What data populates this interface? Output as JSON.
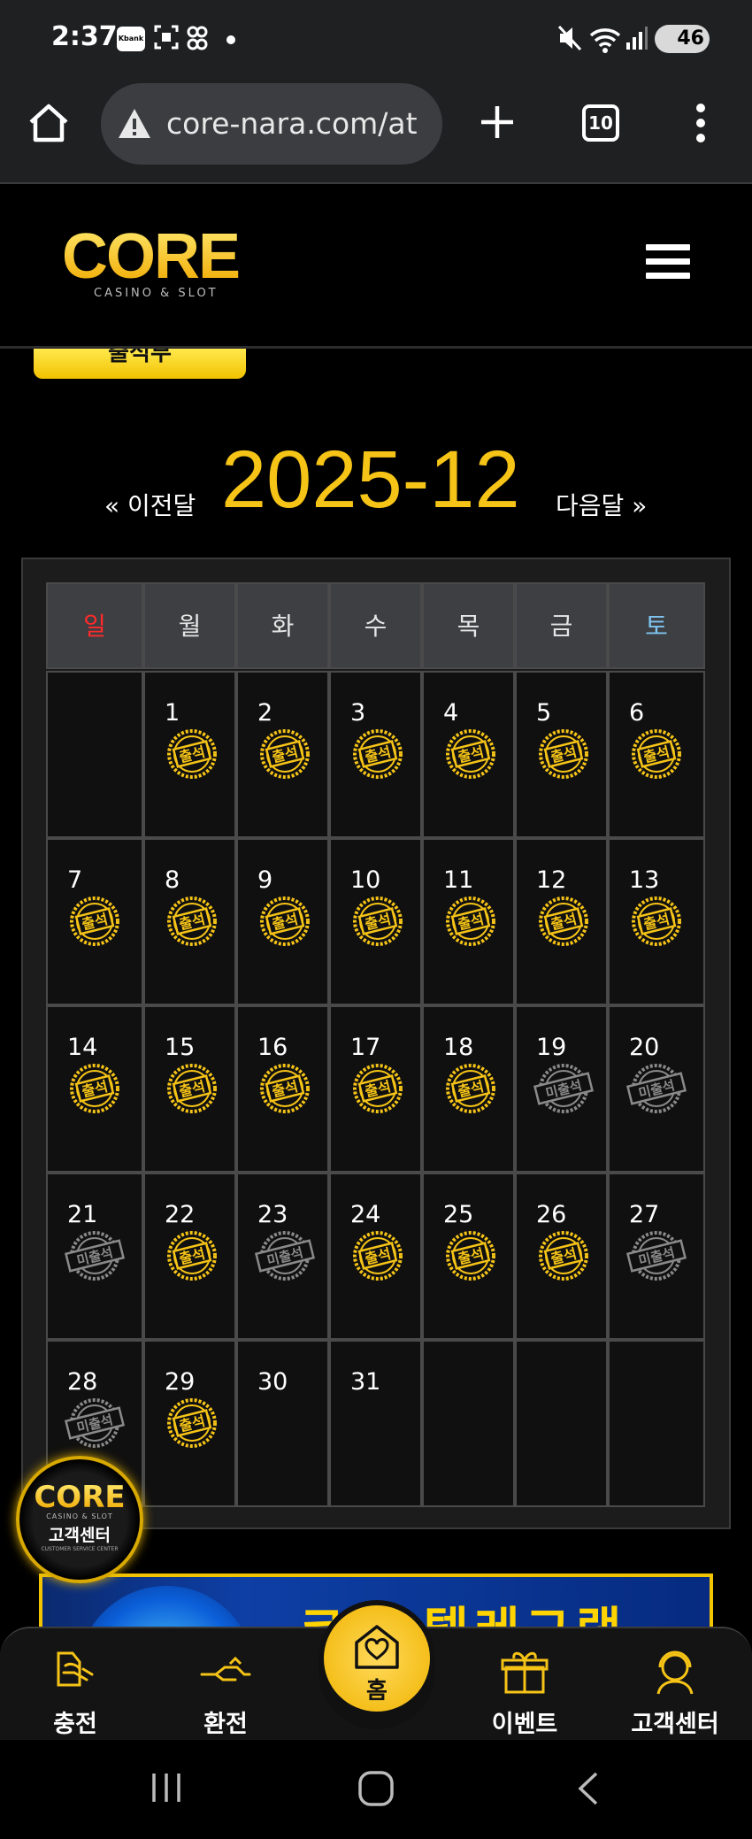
{
  "status_bar": {
    "time": "2:37",
    "kbank_badge": "Kbank",
    "battery": "46",
    "icons": [
      "kbank-icon",
      "screenshot-icon",
      "link-icon",
      "dot-icon",
      "mute-icon",
      "wifi-icon",
      "signal-icon",
      "battery-icon"
    ]
  },
  "browser": {
    "url": "core-nara.com/at",
    "tab_count": "10",
    "icons": [
      "home-icon",
      "warning-icon",
      "plus-icon",
      "tabs-icon",
      "more-vert-icon"
    ]
  },
  "site": {
    "logo_text": "CORE",
    "logo_sub": "CASINO & SLOT",
    "cut_button_label": "출석부"
  },
  "calendar": {
    "prev_label": "« 이전달",
    "next_label": "다음달 »",
    "month": "2025-12",
    "weekdays": [
      "일",
      "월",
      "화",
      "수",
      "목",
      "금",
      "토"
    ],
    "attended_label": "출석",
    "absent_label": "미출석",
    "leading_blanks": 1,
    "days": [
      {
        "day": "1",
        "status": "attended"
      },
      {
        "day": "2",
        "status": "attended"
      },
      {
        "day": "3",
        "status": "attended"
      },
      {
        "day": "4",
        "status": "attended"
      },
      {
        "day": "5",
        "status": "attended"
      },
      {
        "day": "6",
        "status": "attended"
      },
      {
        "day": "7",
        "status": "attended"
      },
      {
        "day": "8",
        "status": "attended"
      },
      {
        "day": "9",
        "status": "attended"
      },
      {
        "day": "10",
        "status": "attended"
      },
      {
        "day": "11",
        "status": "attended"
      },
      {
        "day": "12",
        "status": "attended"
      },
      {
        "day": "13",
        "status": "attended"
      },
      {
        "day": "14",
        "status": "attended"
      },
      {
        "day": "15",
        "status": "attended"
      },
      {
        "day": "16",
        "status": "attended"
      },
      {
        "day": "17",
        "status": "attended"
      },
      {
        "day": "18",
        "status": "attended"
      },
      {
        "day": "19",
        "status": "absent"
      },
      {
        "day": "20",
        "status": "absent"
      },
      {
        "day": "21",
        "status": "absent"
      },
      {
        "day": "22",
        "status": "attended"
      },
      {
        "day": "23",
        "status": "absent"
      },
      {
        "day": "24",
        "status": "attended"
      },
      {
        "day": "25",
        "status": "attended"
      },
      {
        "day": "26",
        "status": "attended"
      },
      {
        "day": "27",
        "status": "absent"
      },
      {
        "day": "28",
        "status": "absent"
      },
      {
        "day": "29",
        "status": "attended"
      },
      {
        "day": "30",
        "status": "none"
      },
      {
        "day": "31",
        "status": "none"
      }
    ],
    "colors": {
      "gold": "#f6c417",
      "sunday": "#ff2a2a",
      "saturday": "#7fc4f2",
      "absent_gray": "#8a8a8a"
    }
  },
  "customer_service_badge": {
    "logo": "CORE",
    "sub": "CASINO & SLOT",
    "label": "고객센터",
    "english": "CUSTOMER SERVICE CENTER"
  },
  "banner": {
    "text": "코어 텔레그램"
  },
  "bottom_nav": {
    "items": [
      {
        "label": "충전",
        "icon": "deposit-icon"
      },
      {
        "label": "환전",
        "icon": "withdraw-icon"
      },
      {
        "label": "홈",
        "icon": "home-heart-icon"
      },
      {
        "label": "이벤트",
        "icon": "gift-icon"
      },
      {
        "label": "고객센터",
        "icon": "support-agent-icon"
      }
    ]
  },
  "system_nav": {
    "icons": [
      "recents-icon",
      "home-circle-icon",
      "back-icon"
    ]
  }
}
